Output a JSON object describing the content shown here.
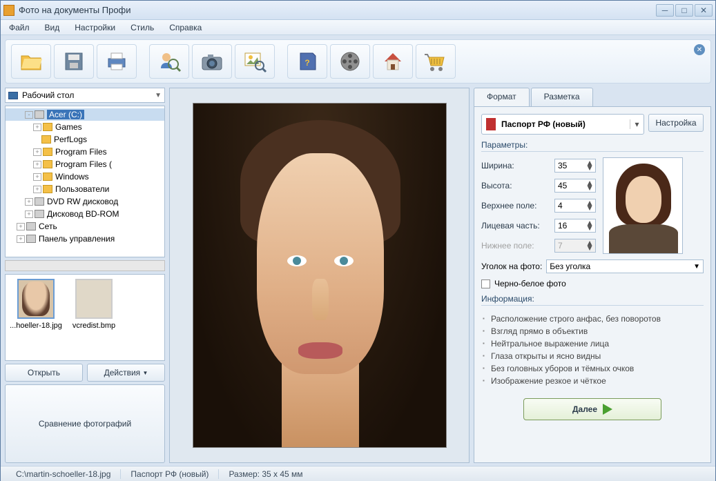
{
  "window": {
    "title": "Фото на документы Профи"
  },
  "menu": [
    "Файл",
    "Вид",
    "Настройки",
    "Стиль",
    "Справка"
  ],
  "toolbar_icons": [
    "open-folder-icon",
    "save-icon",
    "print-icon",
    "zoom-user-icon",
    "camera-icon",
    "image-search-icon",
    "help-book-icon",
    "film-reel-icon",
    "home-icon",
    "cart-icon"
  ],
  "left": {
    "location": "Рабочий стол",
    "thumbs": [
      {
        "name": "...hoeller-18.jpg"
      },
      {
        "name": "vcredist.bmp"
      }
    ],
    "open_btn": "Открыть",
    "actions_btn": "Действия",
    "compare_btn": "Сравнение фотографий"
  },
  "tree": [
    {
      "indent": 2,
      "exp": "-",
      "type": "d",
      "label": "Acer (C:)",
      "selected": true
    },
    {
      "indent": 3,
      "exp": "+",
      "type": "f",
      "label": "Games"
    },
    {
      "indent": 3,
      "exp": "",
      "type": "f",
      "label": "PerfLogs"
    },
    {
      "indent": 3,
      "exp": "+",
      "type": "f",
      "label": "Program Files"
    },
    {
      "indent": 3,
      "exp": "+",
      "type": "f",
      "label": "Program Files ("
    },
    {
      "indent": 3,
      "exp": "+",
      "type": "f",
      "label": "Windows"
    },
    {
      "indent": 3,
      "exp": "+",
      "type": "f",
      "label": "Пользователи"
    },
    {
      "indent": 2,
      "exp": "+",
      "type": "d",
      "label": "DVD RW дисковод"
    },
    {
      "indent": 2,
      "exp": "+",
      "type": "d",
      "label": "Дисковод BD-ROM"
    },
    {
      "indent": 1,
      "exp": "+",
      "type": "d",
      "label": "Сеть"
    },
    {
      "indent": 1,
      "exp": "+",
      "type": "d",
      "label": "Панель управления"
    }
  ],
  "tabs": {
    "format": "Формат",
    "markup": "Разметка"
  },
  "doc": {
    "label": "Паспорт РФ (новый)",
    "settings_btn": "Настройка"
  },
  "sections": {
    "params": "Параметры:",
    "info": "Информация:"
  },
  "params": {
    "width_lbl": "Ширина:",
    "width": "35",
    "height_lbl": "Высота:",
    "height": "45",
    "top_lbl": "Верхнее поле:",
    "top": "4",
    "face_lbl": "Лицевая часть:",
    "face": "16",
    "bottom_lbl": "Нижнее поле:",
    "bottom": "7"
  },
  "corner": {
    "label": "Уголок на фото:",
    "value": "Без уголка"
  },
  "bw": {
    "label": "Черно-белое фото"
  },
  "info": [
    "Расположение строго анфас, без поворотов",
    "Взгляд прямо в объектив",
    "Нейтральное выражение лица",
    "Глаза открыты и ясно видны",
    "Без головных уборов и тёмных очков",
    "Изображение резкое и чёткое"
  ],
  "next_btn": "Далее",
  "status": {
    "path": "C:\\martin-schoeller-18.jpg",
    "doc": "Паспорт РФ (новый)",
    "size": "Размер: 35 x 45 мм"
  },
  "colors": {
    "folder": "#f4c048",
    "drive": "#d0d0d0"
  }
}
